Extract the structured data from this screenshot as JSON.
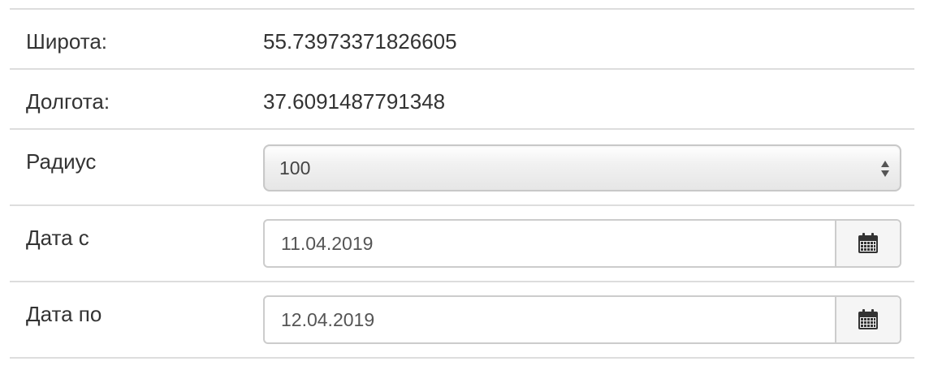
{
  "fields": {
    "latitude": {
      "label": "Широта:",
      "value": "55.73973371826605"
    },
    "longitude": {
      "label": "Долгота:",
      "value": "37.6091487791348"
    },
    "radius": {
      "label": "Радиус",
      "selected": "100"
    },
    "date_from": {
      "label": "Дата с",
      "value": "11.04.2019",
      "button_icon": "calendar-icon"
    },
    "date_to": {
      "label": "Дата по",
      "value": "12.04.2019",
      "button_icon": "calendar-icon"
    }
  }
}
